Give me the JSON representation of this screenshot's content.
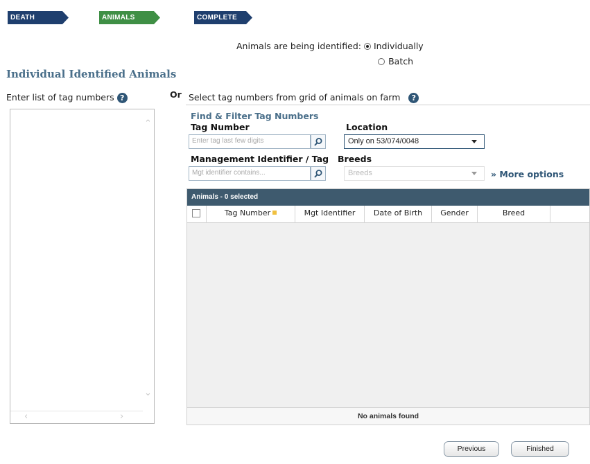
{
  "wizard": {
    "steps": [
      {
        "label": "DEATH",
        "state": "done"
      },
      {
        "label": "ANIMALS",
        "state": "active"
      },
      {
        "label": "COMPLETE",
        "state": "todo"
      }
    ]
  },
  "identification": {
    "label": "Animals are being identified:",
    "options": [
      {
        "label": "Individually",
        "selected": true
      },
      {
        "label": "Batch",
        "selected": false
      }
    ]
  },
  "section": {
    "title": "Individual Identified Animals",
    "left_label": "Enter list of tag numbers",
    "or_label": "Or",
    "right_label": "Select tag numbers from grid of animals on farm"
  },
  "filter": {
    "title": "Find & Filter Tag Numbers",
    "tag_number": {
      "label": "Tag Number",
      "placeholder": "Enter tag last few digits"
    },
    "location": {
      "label": "Location",
      "value": "Only on 53/074/0048"
    },
    "mgmt": {
      "label": "Management Identifier / Tag",
      "placeholder": "Mgt identifier contains..."
    },
    "breeds": {
      "label": "Breeds",
      "placeholder": "Breeds"
    },
    "more_options": "» More options"
  },
  "grid": {
    "header": "Animals - 0 selected",
    "columns": [
      "Tag Number",
      "Mgt Identifier",
      "Date of Birth",
      "Gender",
      "Breed"
    ],
    "empty_message": "No animals found"
  },
  "buttons": {
    "previous": "Previous",
    "finished": "Finished"
  },
  "colors": {
    "step_dark": "#1f3f6e",
    "step_active": "#3f8f45",
    "heading": "#4a6f8a",
    "grid_header": "#3e5a6e"
  }
}
